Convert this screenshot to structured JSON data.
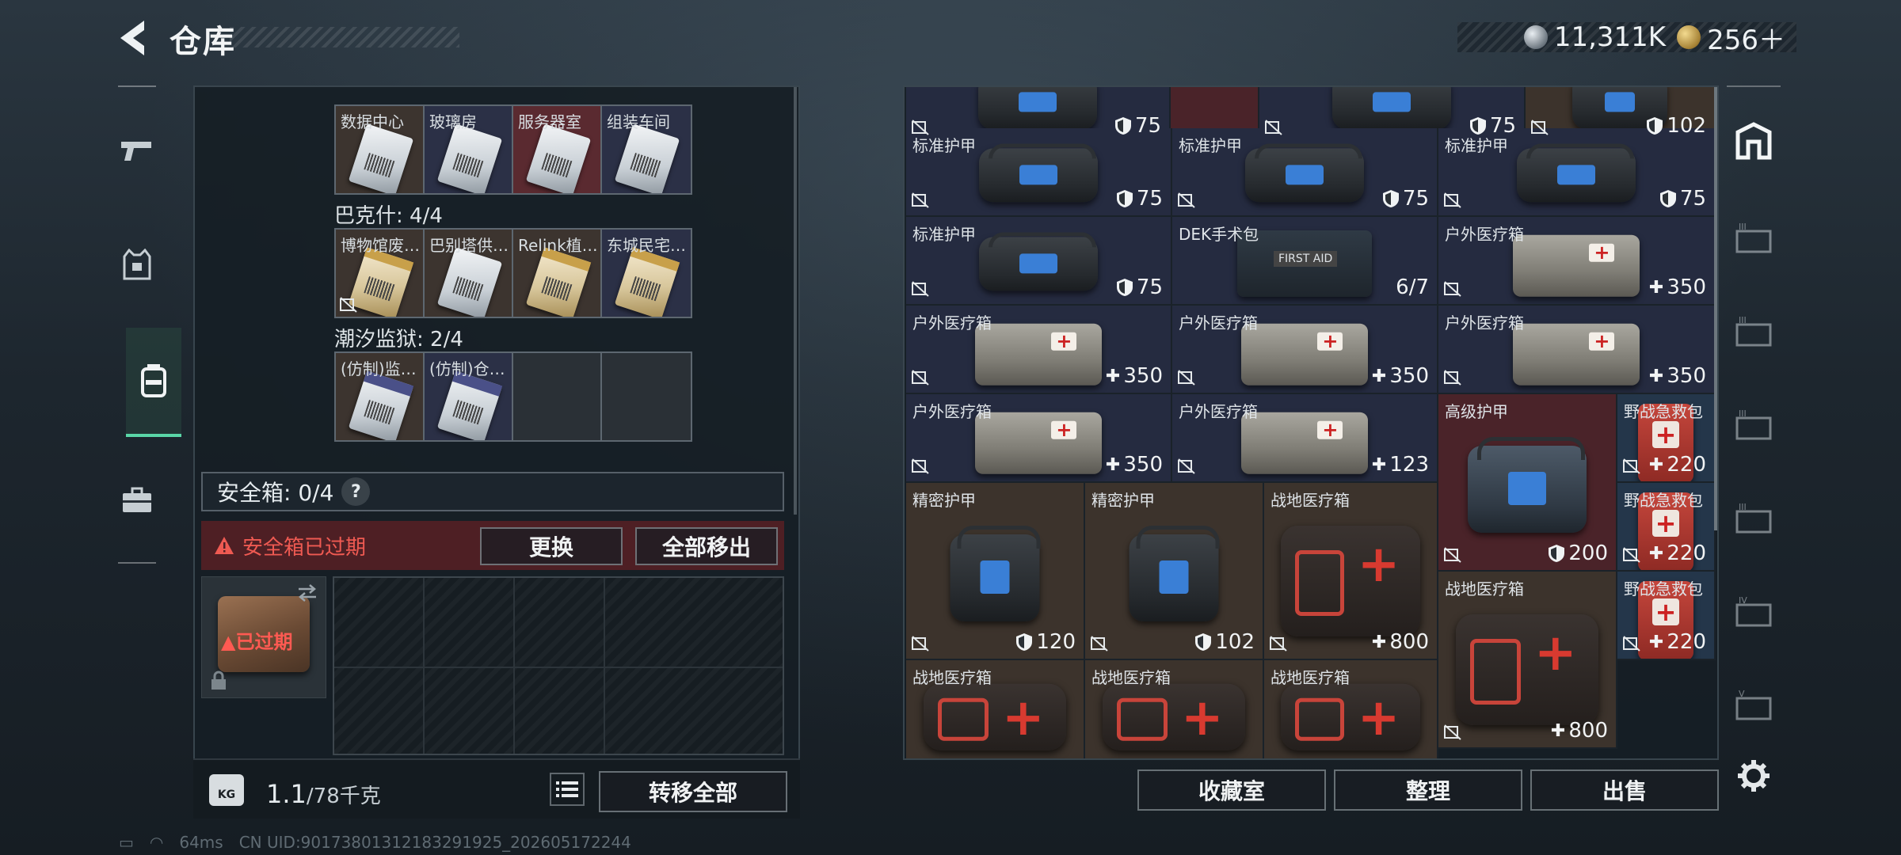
{
  "header": {
    "title": "仓库"
  },
  "currency": {
    "silver": "11,311K",
    "gold": "256＋"
  },
  "left_nav": {
    "items": [
      "weapon",
      "armor",
      "backpack",
      "case"
    ]
  },
  "key_groups": {
    "row1": {
      "keys": [
        {
          "name": "数据中心",
          "bg": "brown"
        },
        {
          "name": "玻璃房",
          "bg": "navy"
        },
        {
          "name": "服务器室",
          "bg": "red"
        },
        {
          "name": "组装车间",
          "bg": "navy"
        }
      ]
    },
    "bakeshi": {
      "label": "巴克什: 4/4",
      "keys": [
        {
          "name": "博物馆废…",
          "bg": "brown",
          "gold": true
        },
        {
          "name": "巴别塔供…",
          "bg": "brown"
        },
        {
          "name": "Relink植…",
          "bg": "brown",
          "gold": true
        },
        {
          "name": "东城民宅…",
          "bg": "navy",
          "gold": true
        }
      ]
    },
    "prison": {
      "label": "潮汐监狱: 2/4",
      "keys": [
        {
          "name": "(仿制)监…",
          "bg": "brown",
          "purple": true
        },
        {
          "name": "(仿制)仓…",
          "bg": "navy",
          "purple": true
        },
        {
          "name": "",
          "bg": "dark"
        },
        {
          "name": "",
          "bg": "dark"
        }
      ]
    }
  },
  "safe_box": {
    "label": "安全箱: 0/4",
    "help": "?",
    "expired_notice": "安全箱已过期",
    "replace_button": "更换",
    "remove_all_button": "全部移出",
    "case_status": "已过期"
  },
  "weight": {
    "current": "1.1",
    "unit": "/78千克",
    "kg_label": "KG"
  },
  "transfer_all_button": "转移全部",
  "stash": {
    "items": [
      {
        "name": "",
        "value": "75",
        "type": "shield",
        "bg": "n",
        "art": "armor"
      },
      {
        "name": "",
        "value": "",
        "type": "",
        "bg": "r",
        "art": "none"
      },
      {
        "name": "",
        "value": "75",
        "type": "shield",
        "bg": "n",
        "art": "armor"
      },
      {
        "name": "标准护甲",
        "value": "75",
        "type": "shield",
        "bg": "n",
        "art": "armor"
      },
      {
        "name": "标准护甲",
        "value": "75",
        "type": "shield",
        "bg": "n",
        "art": "armor"
      },
      {
        "name": "标准护甲",
        "value": "75",
        "type": "shield",
        "bg": "n",
        "art": "armor"
      },
      {
        "name": "标准护甲",
        "value": "75",
        "type": "shield",
        "bg": "n",
        "art": "armor"
      },
      {
        "name": "DEK手术包",
        "value": "6/7",
        "type": "count",
        "bg": "n",
        "art": "dek"
      },
      {
        "name": "户外医疗箱",
        "value": "350",
        "type": "plus",
        "bg": "n",
        "art": "outdoor"
      },
      {
        "name": "户外医疗箱",
        "value": "350",
        "type": "plus",
        "bg": "n",
        "art": "outdoor"
      },
      {
        "name": "户外医疗箱",
        "value": "350",
        "type": "plus",
        "bg": "n",
        "art": "outdoor"
      },
      {
        "name": "户外医疗箱",
        "value": "350",
        "type": "plus",
        "bg": "n",
        "art": "outdoor"
      },
      {
        "name": "户外医疗箱",
        "value": "350",
        "type": "plus",
        "bg": "n",
        "art": "outdoor"
      },
      {
        "name": "户外医疗箱",
        "value": "123",
        "type": "plus",
        "bg": "n",
        "art": "outdoor"
      },
      {
        "name": "高级护甲",
        "value": "200",
        "type": "shield",
        "bg": "r",
        "art": "armor-adv"
      },
      {
        "name": "野战急救包",
        "value": "220",
        "type": "plus",
        "bg": "t",
        "art": "redkit"
      },
      {
        "name": "精密护甲",
        "value": "120",
        "type": "shield",
        "bg": "b",
        "art": "armor"
      },
      {
        "name": "精密护甲",
        "value": "102",
        "type": "shield",
        "bg": "b",
        "art": "armor"
      },
      {
        "name": "战地医疗箱",
        "value": "800",
        "type": "plus",
        "bg": "b",
        "art": "field"
      },
      {
        "name": "战地医疗箱",
        "value": "800",
        "type": "plus",
        "bg": "b",
        "art": "field"
      },
      {
        "name": "野战急救包",
        "value": "220",
        "type": "plus",
        "bg": "t",
        "art": "redkit"
      },
      {
        "name": "战地医疗箱",
        "value": "",
        "type": "",
        "bg": "b",
        "art": "field"
      },
      {
        "name": "战地医疗箱",
        "value": "",
        "type": "",
        "bg": "b",
        "art": "field"
      },
      {
        "name": "战地医疗箱",
        "value": "",
        "type": "",
        "bg": "b",
        "art": "field"
      }
    ]
  },
  "footer_buttons": {
    "collection": "收藏室",
    "sort": "整理",
    "sell": "出售"
  },
  "status": {
    "ping": "64ms",
    "uid": "CN UID:90173801312183291925_202605172244"
  }
}
